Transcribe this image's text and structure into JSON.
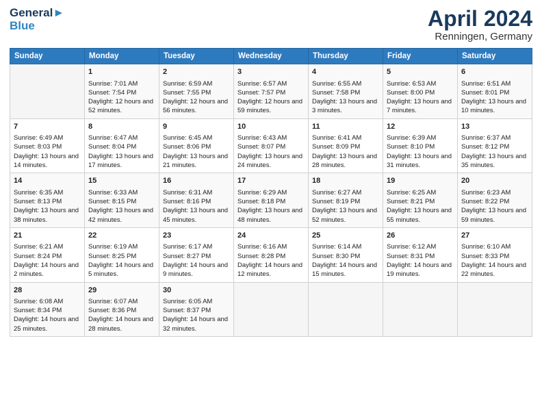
{
  "logo": {
    "line1": "General",
    "line2": "Blue"
  },
  "title": {
    "month": "April 2024",
    "location": "Renningen, Germany"
  },
  "headers": [
    "Sunday",
    "Monday",
    "Tuesday",
    "Wednesday",
    "Thursday",
    "Friday",
    "Saturday"
  ],
  "weeks": [
    [
      {
        "day": "",
        "sunrise": "",
        "sunset": "",
        "daylight": ""
      },
      {
        "day": "1",
        "sunrise": "Sunrise: 7:01 AM",
        "sunset": "Sunset: 7:54 PM",
        "daylight": "Daylight: 12 hours and 52 minutes."
      },
      {
        "day": "2",
        "sunrise": "Sunrise: 6:59 AM",
        "sunset": "Sunset: 7:55 PM",
        "daylight": "Daylight: 12 hours and 56 minutes."
      },
      {
        "day": "3",
        "sunrise": "Sunrise: 6:57 AM",
        "sunset": "Sunset: 7:57 PM",
        "daylight": "Daylight: 12 hours and 59 minutes."
      },
      {
        "day": "4",
        "sunrise": "Sunrise: 6:55 AM",
        "sunset": "Sunset: 7:58 PM",
        "daylight": "Daylight: 13 hours and 3 minutes."
      },
      {
        "day": "5",
        "sunrise": "Sunrise: 6:53 AM",
        "sunset": "Sunset: 8:00 PM",
        "daylight": "Daylight: 13 hours and 7 minutes."
      },
      {
        "day": "6",
        "sunrise": "Sunrise: 6:51 AM",
        "sunset": "Sunset: 8:01 PM",
        "daylight": "Daylight: 13 hours and 10 minutes."
      }
    ],
    [
      {
        "day": "7",
        "sunrise": "Sunrise: 6:49 AM",
        "sunset": "Sunset: 8:03 PM",
        "daylight": "Daylight: 13 hours and 14 minutes."
      },
      {
        "day": "8",
        "sunrise": "Sunrise: 6:47 AM",
        "sunset": "Sunset: 8:04 PM",
        "daylight": "Daylight: 13 hours and 17 minutes."
      },
      {
        "day": "9",
        "sunrise": "Sunrise: 6:45 AM",
        "sunset": "Sunset: 8:06 PM",
        "daylight": "Daylight: 13 hours and 21 minutes."
      },
      {
        "day": "10",
        "sunrise": "Sunrise: 6:43 AM",
        "sunset": "Sunset: 8:07 PM",
        "daylight": "Daylight: 13 hours and 24 minutes."
      },
      {
        "day": "11",
        "sunrise": "Sunrise: 6:41 AM",
        "sunset": "Sunset: 8:09 PM",
        "daylight": "Daylight: 13 hours and 28 minutes."
      },
      {
        "day": "12",
        "sunrise": "Sunrise: 6:39 AM",
        "sunset": "Sunset: 8:10 PM",
        "daylight": "Daylight: 13 hours and 31 minutes."
      },
      {
        "day": "13",
        "sunrise": "Sunrise: 6:37 AM",
        "sunset": "Sunset: 8:12 PM",
        "daylight": "Daylight: 13 hours and 35 minutes."
      }
    ],
    [
      {
        "day": "14",
        "sunrise": "Sunrise: 6:35 AM",
        "sunset": "Sunset: 8:13 PM",
        "daylight": "Daylight: 13 hours and 38 minutes."
      },
      {
        "day": "15",
        "sunrise": "Sunrise: 6:33 AM",
        "sunset": "Sunset: 8:15 PM",
        "daylight": "Daylight: 13 hours and 42 minutes."
      },
      {
        "day": "16",
        "sunrise": "Sunrise: 6:31 AM",
        "sunset": "Sunset: 8:16 PM",
        "daylight": "Daylight: 13 hours and 45 minutes."
      },
      {
        "day": "17",
        "sunrise": "Sunrise: 6:29 AM",
        "sunset": "Sunset: 8:18 PM",
        "daylight": "Daylight: 13 hours and 48 minutes."
      },
      {
        "day": "18",
        "sunrise": "Sunrise: 6:27 AM",
        "sunset": "Sunset: 8:19 PM",
        "daylight": "Daylight: 13 hours and 52 minutes."
      },
      {
        "day": "19",
        "sunrise": "Sunrise: 6:25 AM",
        "sunset": "Sunset: 8:21 PM",
        "daylight": "Daylight: 13 hours and 55 minutes."
      },
      {
        "day": "20",
        "sunrise": "Sunrise: 6:23 AM",
        "sunset": "Sunset: 8:22 PM",
        "daylight": "Daylight: 13 hours and 59 minutes."
      }
    ],
    [
      {
        "day": "21",
        "sunrise": "Sunrise: 6:21 AM",
        "sunset": "Sunset: 8:24 PM",
        "daylight": "Daylight: 14 hours and 2 minutes."
      },
      {
        "day": "22",
        "sunrise": "Sunrise: 6:19 AM",
        "sunset": "Sunset: 8:25 PM",
        "daylight": "Daylight: 14 hours and 5 minutes."
      },
      {
        "day": "23",
        "sunrise": "Sunrise: 6:17 AM",
        "sunset": "Sunset: 8:27 PM",
        "daylight": "Daylight: 14 hours and 9 minutes."
      },
      {
        "day": "24",
        "sunrise": "Sunrise: 6:16 AM",
        "sunset": "Sunset: 8:28 PM",
        "daylight": "Daylight: 14 hours and 12 minutes."
      },
      {
        "day": "25",
        "sunrise": "Sunrise: 6:14 AM",
        "sunset": "Sunset: 8:30 PM",
        "daylight": "Daylight: 14 hours and 15 minutes."
      },
      {
        "day": "26",
        "sunrise": "Sunrise: 6:12 AM",
        "sunset": "Sunset: 8:31 PM",
        "daylight": "Daylight: 14 hours and 19 minutes."
      },
      {
        "day": "27",
        "sunrise": "Sunrise: 6:10 AM",
        "sunset": "Sunset: 8:33 PM",
        "daylight": "Daylight: 14 hours and 22 minutes."
      }
    ],
    [
      {
        "day": "28",
        "sunrise": "Sunrise: 6:08 AM",
        "sunset": "Sunset: 8:34 PM",
        "daylight": "Daylight: 14 hours and 25 minutes."
      },
      {
        "day": "29",
        "sunrise": "Sunrise: 6:07 AM",
        "sunset": "Sunset: 8:36 PM",
        "daylight": "Daylight: 14 hours and 28 minutes."
      },
      {
        "day": "30",
        "sunrise": "Sunrise: 6:05 AM",
        "sunset": "Sunset: 8:37 PM",
        "daylight": "Daylight: 14 hours and 32 minutes."
      },
      {
        "day": "",
        "sunrise": "",
        "sunset": "",
        "daylight": ""
      },
      {
        "day": "",
        "sunrise": "",
        "sunset": "",
        "daylight": ""
      },
      {
        "day": "",
        "sunrise": "",
        "sunset": "",
        "daylight": ""
      },
      {
        "day": "",
        "sunrise": "",
        "sunset": "",
        "daylight": ""
      }
    ]
  ]
}
